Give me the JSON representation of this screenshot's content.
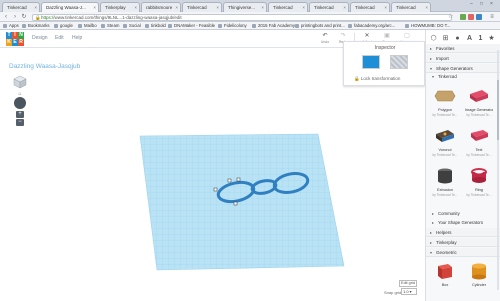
{
  "browser": {
    "tabs": [
      {
        "label": "Tinkercad"
      },
      {
        "label": "Dazzling Waasa-J..."
      },
      {
        "label": "Tinkerplay"
      },
      {
        "label": "rabbitsmoore"
      },
      {
        "label": "Tinkercad"
      },
      {
        "label": "Thingiverse..."
      },
      {
        "label": "Tinkercad"
      },
      {
        "label": "Tinkercad"
      },
      {
        "label": "Tinkercad"
      },
      {
        "label": "Tinkercad"
      }
    ],
    "url_scheme": "https://",
    "url_host": "www.tinkercad.com",
    "url_path": "/things/9LNL...1-dazzling-waasa-jasqjub/edit",
    "bookmarks": [
      "Apps",
      "Bookmarks",
      "google",
      "Mailbo",
      "Steam",
      "Social",
      "tinkbold",
      "DNAMaker - Feasible",
      "Fidelicolony",
      "2015 Fab Academy",
      "printingbots and print...",
      "fabacademy.org/arc...",
      "HOWMUMB: DO T..."
    ]
  },
  "app": {
    "logo_letters": [
      "T",
      "I",
      "N",
      "K",
      "E",
      "R"
    ],
    "menu": [
      "Design",
      "Edit",
      "Help"
    ],
    "toolbar": [
      "Undo",
      "Redo",
      "Adjust",
      "Group",
      "Ungroup"
    ],
    "design_title": "Dazzling Waasa-Jasqjub"
  },
  "inspector": {
    "title": "Inspector",
    "lock_label": "Lock transformation"
  },
  "snap": {
    "edit_grid_label": "Edit grid",
    "snap_grid_label": "Snap grid",
    "snap_value": "1.0 ▾"
  },
  "panel": {
    "sections": {
      "favorites": "Favorites",
      "import": "Import",
      "shape_generators": "Shape Generators",
      "tinkercad": "Tinkercad",
      "community": "Community",
      "your_generators": "Your Shape Generators",
      "helpers": "Helpers",
      "tinkerplay": "Tinkerplay",
      "geometric": "Geometric"
    },
    "generators": [
      {
        "name": "Polygon",
        "by": "by Tinkercad Te..."
      },
      {
        "name": "Image Generator",
        "by": "by Tinkercad Te..."
      },
      {
        "name": "Voronoi",
        "by": "by Tinkercad Te..."
      },
      {
        "name": "Text",
        "by": "by Tinkercad Te..."
      },
      {
        "name": "Extrusion",
        "by": "by Tinkercad Te..."
      },
      {
        "name": "Ring",
        "by": "by Tinkercad Te..."
      }
    ],
    "geometric": [
      {
        "name": "Box"
      },
      {
        "name": "Cylinder"
      }
    ]
  },
  "colors": {
    "accent": "#1e8fd6",
    "workplane": "#b9e2f5",
    "grid_line": "#8fcbe9",
    "object": "#2f7fc1"
  }
}
